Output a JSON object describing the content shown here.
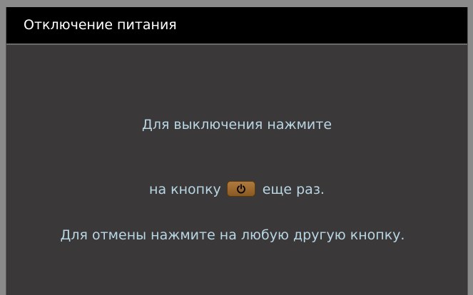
{
  "dialog": {
    "title": "Отключение питания",
    "line1": "Для выключения нажмите",
    "line2_before": "на кнопку",
    "line2_after": "еще раз.",
    "line3": "Для отмены нажмите на любую другую кнопку.",
    "power_icon": "power-icon",
    "power_key_color": "#a06b2e"
  }
}
